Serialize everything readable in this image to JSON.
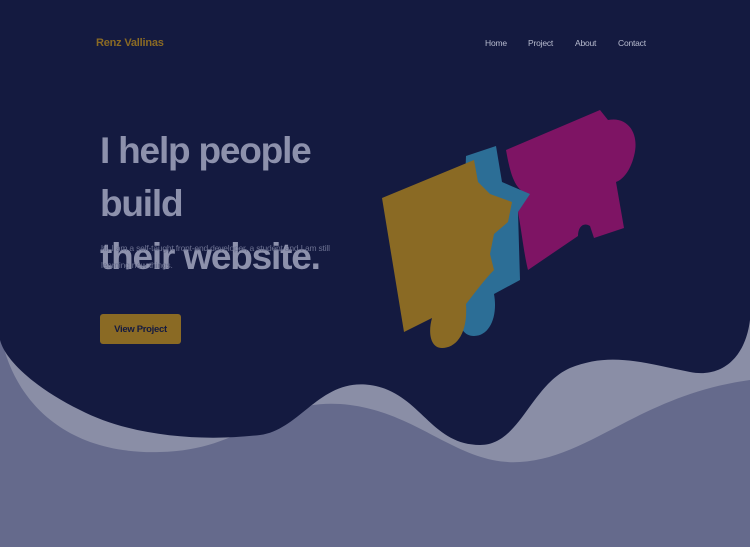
{
  "header": {
    "logo": "Renz Vallinas",
    "nav": [
      "Home",
      "Project",
      "About",
      "Contact"
    ]
  },
  "hero": {
    "title_line1": "I help people build",
    "title_line2": "their website.",
    "subtitle": "hi, I am a self-taught front-end developer, a student and I am still learning new things.",
    "cta": "View Project"
  },
  "colors": {
    "navy": "#141a40",
    "gold": "#8a6a24",
    "teal": "#2c6e96",
    "magenta": "#7e1464",
    "page_bottom": "#8a8ea6"
  },
  "icons": [
    "puzzle-pieces-illustration"
  ]
}
